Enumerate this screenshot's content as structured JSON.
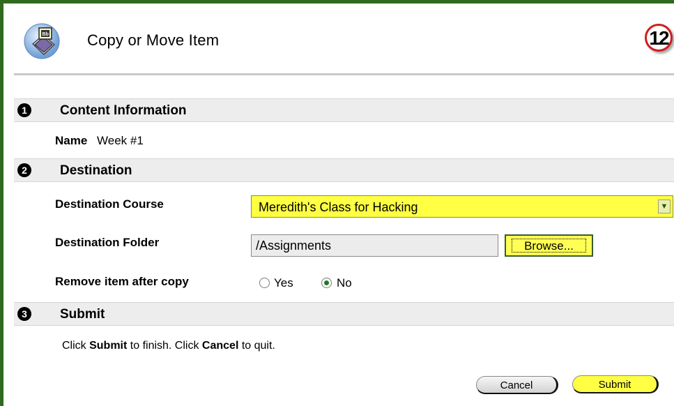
{
  "header": {
    "title": "Copy or Move Item",
    "step_number": "12",
    "icon": "blackboard-book-icon"
  },
  "sections": [
    {
      "number": "1",
      "title": "Content Information"
    },
    {
      "number": "2",
      "title": "Destination"
    },
    {
      "number": "3",
      "title": "Submit"
    }
  ],
  "content_info": {
    "name_label": "Name",
    "name_value": "Week #1"
  },
  "destination": {
    "course_label": "Destination Course",
    "course_value": "Meredith's Class for Hacking",
    "folder_label": "Destination Folder",
    "folder_value": "/Assignments",
    "browse_label": "Browse...",
    "remove_label": "Remove item after copy",
    "remove_options": [
      {
        "label": "Yes",
        "checked": false
      },
      {
        "label": "No",
        "checked": true
      }
    ]
  },
  "submit": {
    "instruction_part1": "Click ",
    "instruction_bold1": "Submit",
    "instruction_part2": " to finish. Click ",
    "instruction_bold2": "Cancel",
    "instruction_part3": " to quit.",
    "cancel_label": "Cancel",
    "submit_label": "Submit"
  },
  "colors": {
    "frame": "#2f6a1f",
    "highlight": "#ffff44",
    "section_bar": "#ededed",
    "badge_ring": "#d11c1c"
  }
}
